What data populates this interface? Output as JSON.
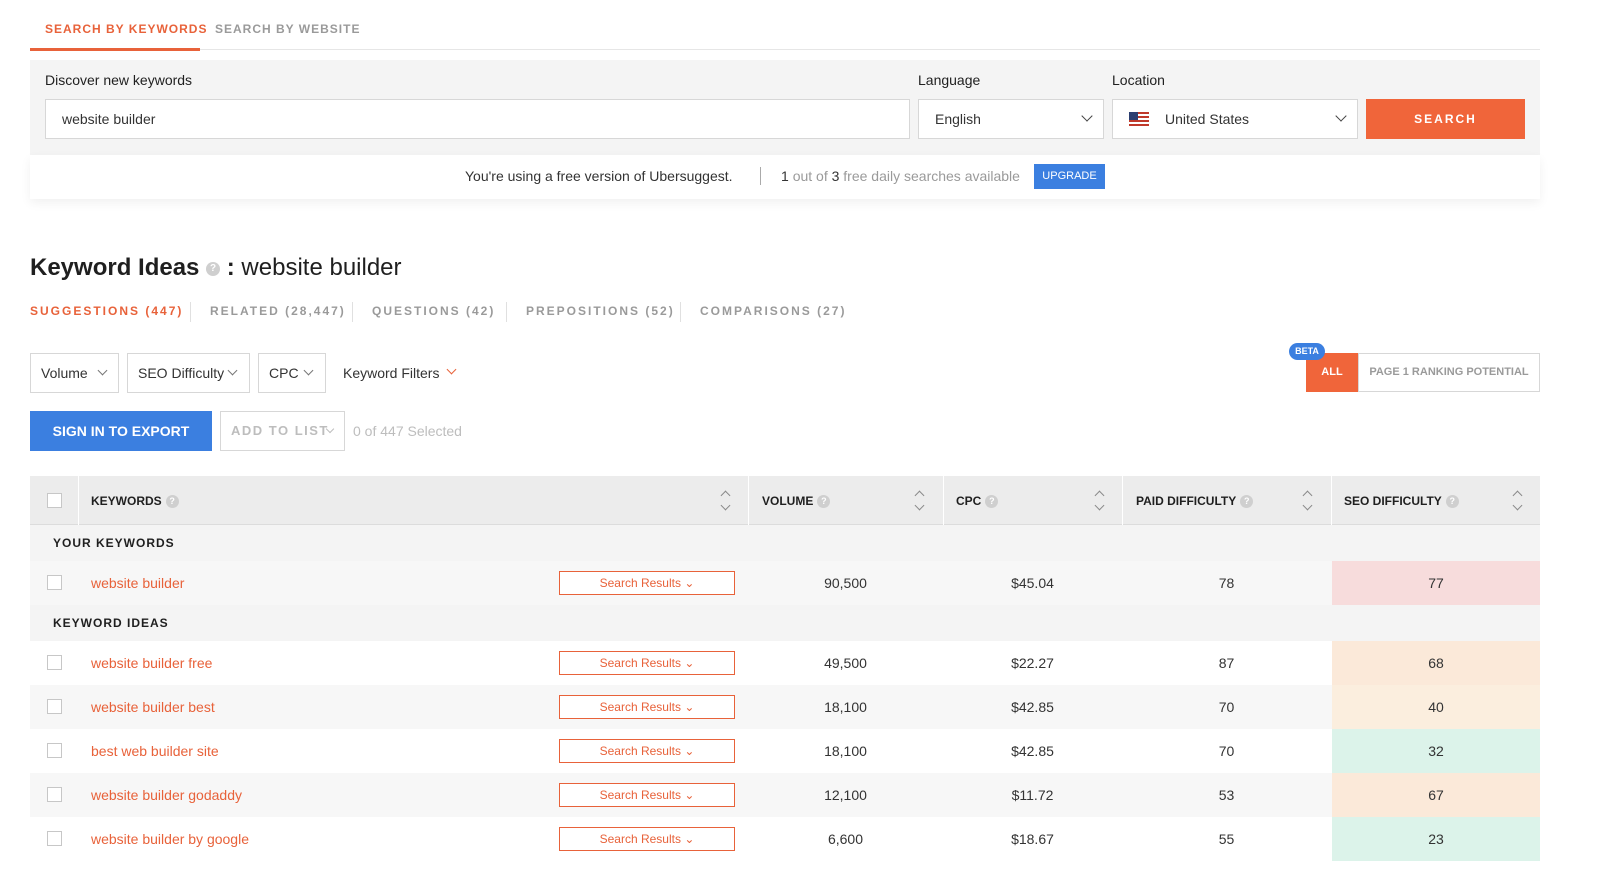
{
  "top_tabs": [
    {
      "label": "SEARCH BY KEYWORDS",
      "active": true
    },
    {
      "label": "SEARCH BY WEBSITE",
      "active": false
    }
  ],
  "search": {
    "keyword_label": "Discover new keywords",
    "keyword_value": "website builder",
    "language_label": "Language",
    "language_value": "English",
    "location_label": "Location",
    "location_value": "United States",
    "button_label": "SEARCH"
  },
  "notice": {
    "text": "You're using a free version of Ubersuggest.",
    "count_used": "1",
    "count_mid": "out of",
    "count_total": "3",
    "count_suffix": "free daily searches available",
    "upgrade_label": "UPGRADE"
  },
  "heading": {
    "title": "Keyword Ideas",
    "separator": ":",
    "query": "website builder",
    "help": "?"
  },
  "sub_tabs": [
    {
      "label": "SUGGESTIONS (447)",
      "active": true
    },
    {
      "label": "RELATED (28,447)",
      "active": false
    },
    {
      "label": "QUESTIONS (42)",
      "active": false
    },
    {
      "label": "PREPOSITIONS (52)",
      "active": false
    },
    {
      "label": "COMPARISONS (27)",
      "active": false
    }
  ],
  "filters": {
    "volume": "Volume",
    "seo_difficulty": "SEO Difficulty",
    "cpc": "CPC",
    "keyword_filters": "Keyword Filters"
  },
  "toggle": {
    "beta": "BETA",
    "all": "ALL",
    "page1": "PAGE 1 RANKING POTENTIAL"
  },
  "actions": {
    "export": "SIGN IN TO EXPORT",
    "add_to_list": "ADD TO LIST",
    "selected": "0 of 447 Selected"
  },
  "table": {
    "headers": {
      "keywords": "KEYWORDS",
      "volume": "VOLUME",
      "cpc": "CPC",
      "paid": "PAID DIFFICULTY",
      "seo": "SEO DIFFICULTY"
    },
    "groups": {
      "yours": "YOUR KEYWORDS",
      "ideas": "KEYWORD IDEAS"
    },
    "search_results_label": "Search Results",
    "your_rows": [
      {
        "keyword": "website builder",
        "volume": "90,500",
        "cpc": "$45.04",
        "paid": "78",
        "seo": "77",
        "seo_color": "#f7dcdc"
      }
    ],
    "idea_rows": [
      {
        "keyword": "website builder free",
        "volume": "49,500",
        "cpc": "$22.27",
        "paid": "87",
        "seo": "68",
        "seo_color": "#fbe9d9"
      },
      {
        "keyword": "website builder best",
        "volume": "18,100",
        "cpc": "$42.85",
        "paid": "70",
        "seo": "40",
        "seo_color": "#fbeede"
      },
      {
        "keyword": "best web builder site",
        "volume": "18,100",
        "cpc": "$42.85",
        "paid": "70",
        "seo": "32",
        "seo_color": "#dcf3ea"
      },
      {
        "keyword": "website builder godaddy",
        "volume": "12,100",
        "cpc": "$11.72",
        "paid": "53",
        "seo": "67",
        "seo_color": "#fbe9d9"
      },
      {
        "keyword": "website builder by google",
        "volume": "6,600",
        "cpc": "$18.67",
        "paid": "55",
        "seo": "23",
        "seo_color": "#dcf3ea"
      }
    ]
  },
  "colors": {
    "accent": "#e8623a",
    "primary_blue": "#3b7fe0"
  }
}
